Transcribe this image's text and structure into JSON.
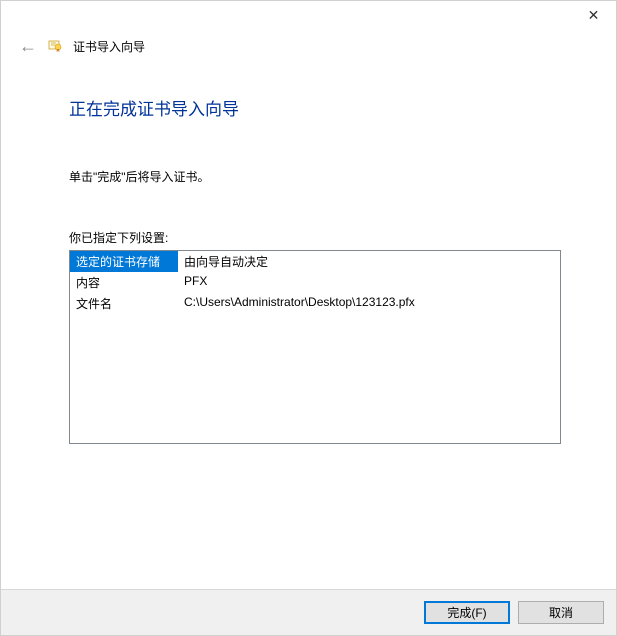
{
  "window": {
    "title": "证书导入向导"
  },
  "page": {
    "heading": "正在完成证书导入向导",
    "instruction": "单击\"完成\"后将导入证书。",
    "settings_label": "你已指定下列设置:"
  },
  "settings": {
    "rows": [
      {
        "key": "选定的证书存储",
        "value": "由向导自动决定"
      },
      {
        "key": "内容",
        "value": "PFX"
      },
      {
        "key": "文件名",
        "value": "C:\\Users\\Administrator\\Desktop\\123123.pfx"
      }
    ]
  },
  "buttons": {
    "finish": "完成(F)",
    "cancel": "取消"
  }
}
